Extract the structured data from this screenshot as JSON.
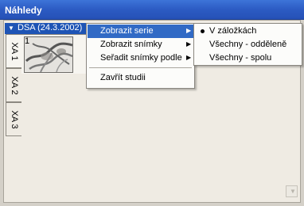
{
  "window": {
    "title": "Náhledy"
  },
  "series_header": {
    "label": "DSA (24.3.2002)"
  },
  "tabs": [
    {
      "label": "XA 1"
    },
    {
      "label": "XA 2"
    },
    {
      "label": "XA 3"
    }
  ],
  "thumbnail": {
    "number": "1"
  },
  "context_menu": {
    "items": [
      {
        "label": "Zobrazit serie",
        "has_submenu": true,
        "selected": true
      },
      {
        "label": "Zobrazit snímky",
        "has_submenu": true
      },
      {
        "label": "Seřadit snímky podle",
        "has_submenu": true
      },
      {
        "label": "Zavřít studii",
        "has_submenu": false
      }
    ]
  },
  "submenu": {
    "items": [
      {
        "label": "V záložkách",
        "checked": true
      },
      {
        "label": "Všechny - odděleně"
      },
      {
        "label": "Všechny - spolu"
      }
    ]
  },
  "colors": {
    "title_bar": "#2c5bc3",
    "menu_highlight": "#316ac5",
    "client_bg": "#efebe3"
  }
}
